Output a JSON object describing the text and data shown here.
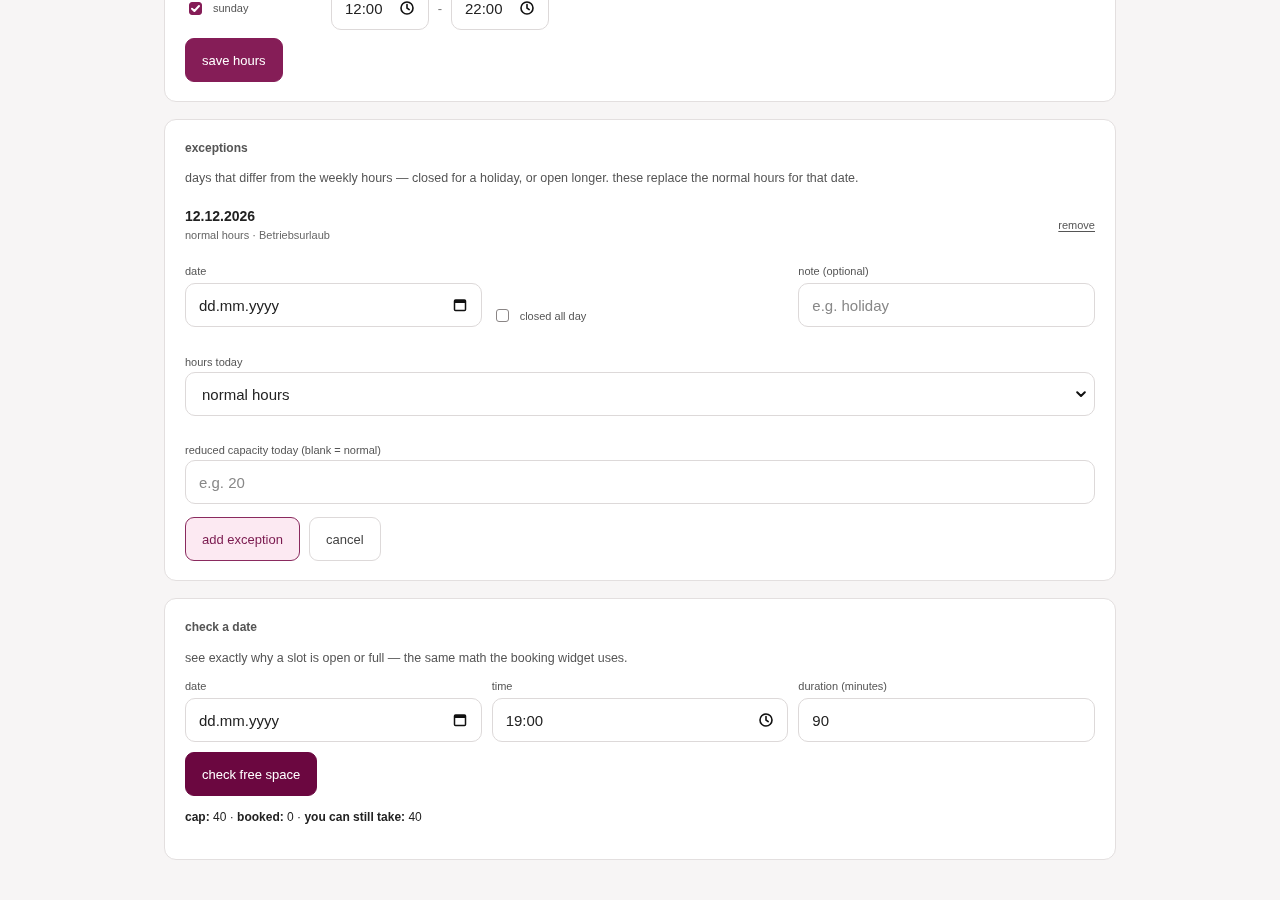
{
  "weekly_hours": {
    "days": [
      {
        "label": "sunday",
        "checked": true,
        "open": "12:00",
        "separator": "-",
        "close": "22:00"
      }
    ],
    "save_button": "save hours"
  },
  "exceptions": {
    "title": "exceptions",
    "description": "days that differ from the weekly hours — closed for a holiday, or open longer. these replace the normal hours for that date.",
    "items": [
      {
        "date": "12.12.2026",
        "detail": "normal hours · Betriebsurlaub",
        "remove": "remove"
      }
    ],
    "form": {
      "date": {
        "label": "date",
        "placeholder": "dd.mm.yyyy"
      },
      "closed_all_day": {
        "label": "closed all day",
        "checked": false
      },
      "note": {
        "label": "note (optional)",
        "placeholder": "e.g. holiday"
      },
      "hours_today": {
        "label": "hours today",
        "value": "normal hours"
      },
      "reduced_capacity": {
        "label": "reduced capacity today (blank = normal)",
        "placeholder": "e.g. 20"
      },
      "buttons": [
        {
          "label": "add exception",
          "kind": "primary"
        },
        {
          "label": "cancel",
          "kind": "secondary"
        }
      ]
    }
  },
  "check_date": {
    "title": "check a date",
    "description": "see exactly why a slot is open or full — the same math the booking widget uses.",
    "fields": [
      {
        "label": "date",
        "kind": "date",
        "placeholder": "dd.mm.yyyy"
      },
      {
        "label": "time",
        "kind": "time",
        "value": "19:00"
      },
      {
        "label": "duration (minutes)",
        "kind": "number",
        "value": "90"
      }
    ],
    "button": "check free space",
    "result": "**cap:** 40 · **booked:** 0 · **you can still take:** 40"
  }
}
